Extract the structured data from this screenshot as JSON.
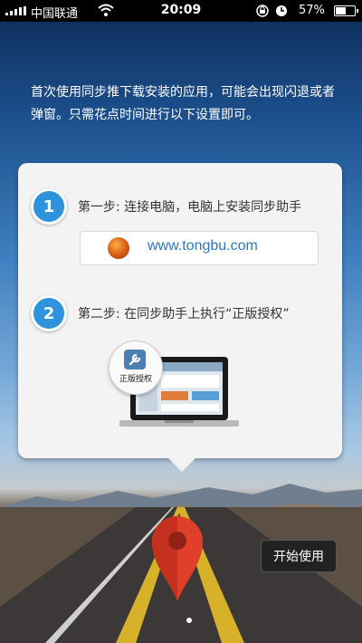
{
  "status_bar": {
    "carrier": "中国联通",
    "time": "20:09",
    "battery": "57%",
    "battery_level": 0.57
  },
  "intro_text": "首次使用同步推下载安装的应用，可能会出现闪退或者弹窗。只需花点时间进行以下设置即可。",
  "steps": [
    {
      "number": "1",
      "text": "第一步: 连接电脑，电脑上安装同步助手"
    },
    {
      "number": "2",
      "text": "第二步: 在同步助手上执行“正版授权”"
    }
  ],
  "download_url": "www.tongbu.com",
  "authorize_badge": "正版授权",
  "start_button": "开始使用",
  "icons": [
    "signal-icon",
    "wifi-icon",
    "rotation-lock-icon",
    "alarm-icon",
    "battery-icon",
    "tongbu-logo-icon",
    "wrench-icon",
    "laptop-image",
    "map-pin-icon"
  ],
  "colors": {
    "accent": "#2e93dc",
    "pin": "#e0402a",
    "link": "#2a76c6"
  }
}
